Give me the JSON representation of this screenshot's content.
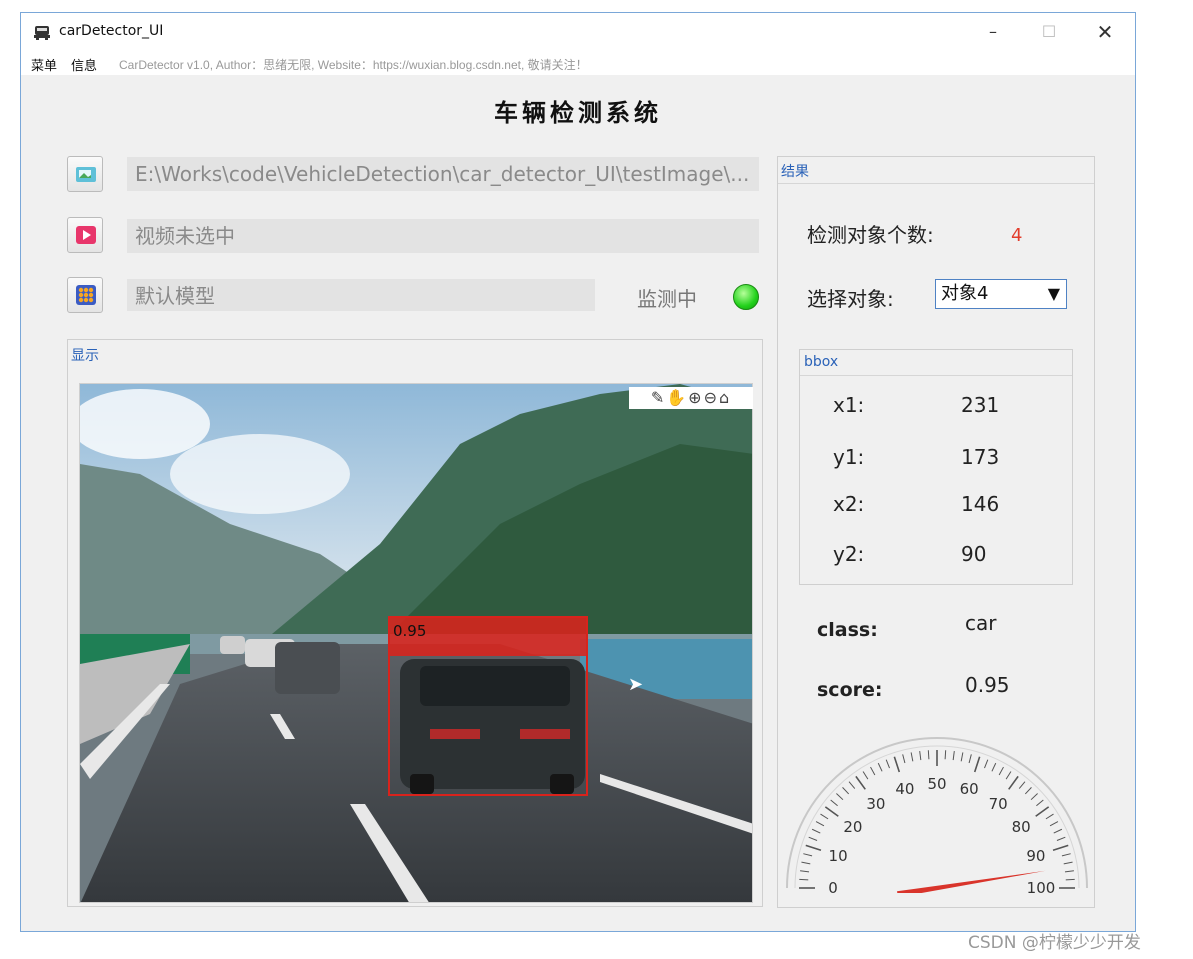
{
  "window": {
    "title": "carDetector_UI",
    "minimize_icon": "minimize-icon",
    "maximize_icon": "maximize-icon",
    "close_icon": "close-icon"
  },
  "menu": {
    "items": [
      "菜单",
      "信息"
    ],
    "info_text": "CarDetector v1.0, Author：思绪无限, Website：https://wuxian.blog.csdn.net, 敬请关注！"
  },
  "main_title": "车辆检测系统",
  "inputs": {
    "image_path": "E:\\Works\\code\\VehicleDetection\\car_detector_UI\\testImage\\...",
    "video_status": "视频未选中",
    "model_name": "默认模型",
    "monitor_label": "监测中",
    "monitor_color": "#22d11b"
  },
  "display": {
    "title": "显示",
    "toolbar_icons": [
      "edit-icon",
      "pan-icon",
      "zoom-in-icon",
      "zoom-out-icon",
      "home-icon"
    ],
    "box_score": "0.95",
    "box_color": "#d9231c"
  },
  "result": {
    "title": "结果",
    "count_label": "检测对象个数:",
    "count_value": "4",
    "select_label": "选择对象:",
    "select_value": "对象4",
    "bbox_title": "bbox",
    "bbox": [
      {
        "label": "x1:",
        "value": "231"
      },
      {
        "label": "y1:",
        "value": "173"
      },
      {
        "label": "x2:",
        "value": "146"
      },
      {
        "label": "y2:",
        "value": "90"
      }
    ],
    "class_label": "class:",
    "class_value": "car",
    "score_label": "score:",
    "score_value": "0.95"
  },
  "gauge": {
    "ticks": [
      "0",
      "10",
      "20",
      "30",
      "40",
      "50",
      "60",
      "70",
      "80",
      "90",
      "100"
    ],
    "value": 95
  },
  "watermark": "CSDN @柠檬少少开发"
}
